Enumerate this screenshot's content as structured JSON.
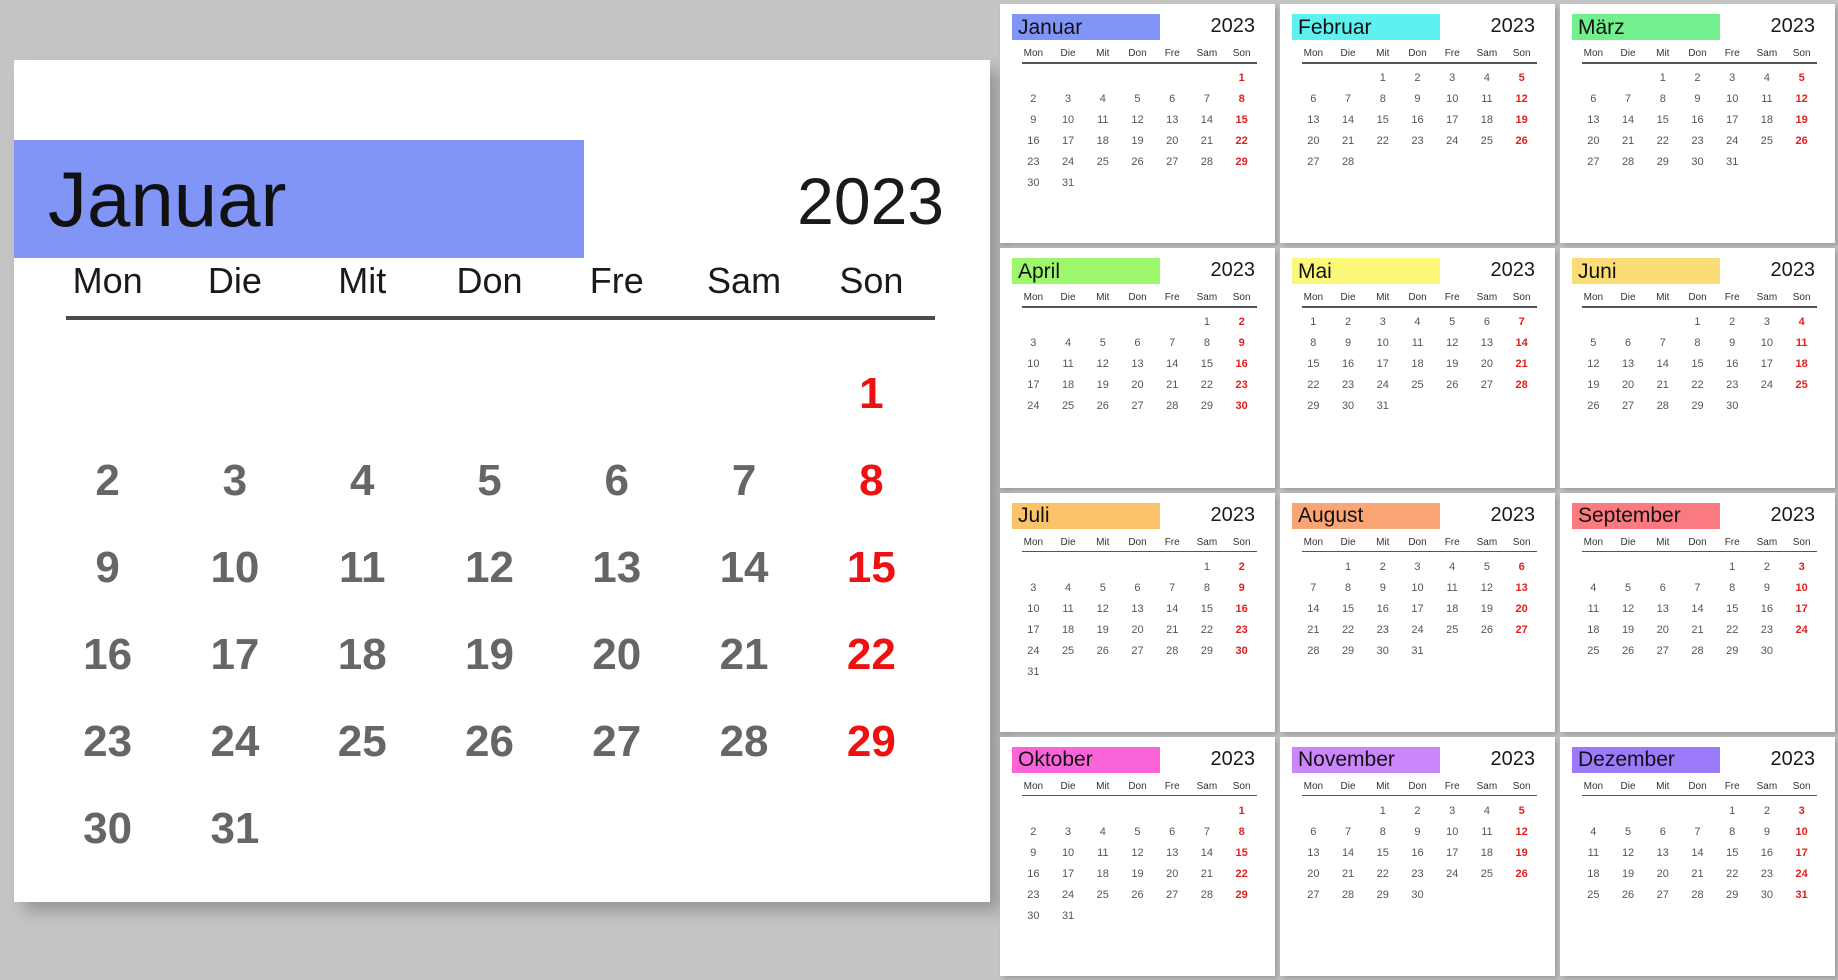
{
  "year": "2023",
  "weekdays": [
    "Mon",
    "Die",
    "Mit",
    "Don",
    "Fre",
    "Sam",
    "Son"
  ],
  "colors": {
    "page_background": "#c4c4c4",
    "panel_background": "#ffffff",
    "weekday_text": "#1a1a1a",
    "day_text": "#666666",
    "sunday_text": "#ee1111",
    "rule": "#4a4a4a"
  },
  "main": {
    "month": "Januar",
    "year": "2023",
    "band_color": "#8095f5",
    "weekdays": [
      "Mon",
      "Die",
      "Mit",
      "Don",
      "Fre",
      "Sam",
      "Son"
    ],
    "leading_blanks": 6,
    "days_in_month": 31,
    "weeks": [
      [
        "",
        "",
        "",
        "",
        "",
        "",
        "1"
      ],
      [
        "2",
        "3",
        "4",
        "5",
        "6",
        "7",
        "8"
      ],
      [
        "9",
        "10",
        "11",
        "12",
        "13",
        "14",
        "15"
      ],
      [
        "16",
        "17",
        "18",
        "19",
        "20",
        "21",
        "22"
      ],
      [
        "23",
        "24",
        "25",
        "26",
        "27",
        "28",
        "29"
      ],
      [
        "30",
        "31",
        "",
        "",
        "",
        "",
        ""
      ]
    ]
  },
  "months": [
    {
      "name": "Januar",
      "year": "2023",
      "band_color": "#8095f5",
      "leading_blanks": 6,
      "days_in_month": 31,
      "weeks": [
        [
          "",
          "",
          "",
          "",
          "",
          "",
          "1"
        ],
        [
          "2",
          "3",
          "4",
          "5",
          "6",
          "7",
          "8"
        ],
        [
          "9",
          "10",
          "11",
          "12",
          "13",
          "14",
          "15"
        ],
        [
          "16",
          "17",
          "18",
          "19",
          "20",
          "21",
          "22"
        ],
        [
          "23",
          "24",
          "25",
          "26",
          "27",
          "28",
          "29"
        ],
        [
          "30",
          "31",
          "",
          "",
          "",
          "",
          ""
        ]
      ]
    },
    {
      "name": "Februar",
      "year": "2023",
      "band_color": "#5ff0f0",
      "leading_blanks": 2,
      "days_in_month": 28,
      "weeks": [
        [
          "",
          "",
          "1",
          "2",
          "3",
          "4",
          "5"
        ],
        [
          "6",
          "7",
          "8",
          "9",
          "10",
          "11",
          "12"
        ],
        [
          "13",
          "14",
          "15",
          "16",
          "17",
          "18",
          "19"
        ],
        [
          "20",
          "21",
          "22",
          "23",
          "24",
          "25",
          "26"
        ],
        [
          "27",
          "28",
          "",
          "",
          "",
          "",
          ""
        ],
        [
          "",
          "",
          "",
          "",
          "",
          "",
          ""
        ]
      ]
    },
    {
      "name": "März",
      "year": "2023",
      "band_color": "#72f08e",
      "leading_blanks": 2,
      "days_in_month": 31,
      "weeks": [
        [
          "",
          "",
          "1",
          "2",
          "3",
          "4",
          "5"
        ],
        [
          "6",
          "7",
          "8",
          "9",
          "10",
          "11",
          "12"
        ],
        [
          "13",
          "14",
          "15",
          "16",
          "17",
          "18",
          "19"
        ],
        [
          "20",
          "21",
          "22",
          "23",
          "24",
          "25",
          "26"
        ],
        [
          "27",
          "28",
          "29",
          "30",
          "31",
          "",
          ""
        ],
        [
          "",
          "",
          "",
          "",
          "",
          "",
          ""
        ]
      ]
    },
    {
      "name": "April",
      "year": "2023",
      "band_color": "#9cf76a",
      "leading_blanks": 5,
      "days_in_month": 30,
      "weeks": [
        [
          "",
          "",
          "",
          "",
          "",
          "1",
          "2"
        ],
        [
          "3",
          "4",
          "5",
          "6",
          "7",
          "8",
          "9"
        ],
        [
          "10",
          "11",
          "12",
          "13",
          "14",
          "15",
          "16"
        ],
        [
          "17",
          "18",
          "19",
          "20",
          "21",
          "22",
          "23"
        ],
        [
          "24",
          "25",
          "26",
          "27",
          "28",
          "29",
          "30"
        ],
        [
          "",
          "",
          "",
          "",
          "",
          "",
          ""
        ]
      ]
    },
    {
      "name": "Mai",
      "year": "2023",
      "band_color": "#fbf87a",
      "leading_blanks": 0,
      "days_in_month": 31,
      "weeks": [
        [
          "1",
          "2",
          "3",
          "4",
          "5",
          "6",
          "7"
        ],
        [
          "8",
          "9",
          "10",
          "11",
          "12",
          "13",
          "14"
        ],
        [
          "15",
          "16",
          "17",
          "18",
          "19",
          "20",
          "21"
        ],
        [
          "22",
          "23",
          "24",
          "25",
          "26",
          "27",
          "28"
        ],
        [
          "29",
          "30",
          "31",
          "",
          "",
          "",
          ""
        ],
        [
          "",
          "",
          "",
          "",
          "",
          "",
          ""
        ]
      ]
    },
    {
      "name": "Juni",
      "year": "2023",
      "band_color": "#fbdd78",
      "leading_blanks": 3,
      "days_in_month": 30,
      "weeks": [
        [
          "",
          "",
          "",
          "1",
          "2",
          "3",
          "4"
        ],
        [
          "5",
          "6",
          "7",
          "8",
          "9",
          "10",
          "11"
        ],
        [
          "12",
          "13",
          "14",
          "15",
          "16",
          "17",
          "18"
        ],
        [
          "19",
          "20",
          "21",
          "22",
          "23",
          "24",
          "25"
        ],
        [
          "26",
          "27",
          "28",
          "29",
          "30",
          "",
          ""
        ],
        [
          "",
          "",
          "",
          "",
          "",
          "",
          ""
        ]
      ]
    },
    {
      "name": "Juli",
      "year": "2023",
      "band_color": "#fbc46a",
      "leading_blanks": 5,
      "days_in_month": 31,
      "weeks": [
        [
          "",
          "",
          "",
          "",
          "",
          "1",
          "2"
        ],
        [
          "3",
          "4",
          "5",
          "6",
          "7",
          "8",
          "9"
        ],
        [
          "10",
          "11",
          "12",
          "13",
          "14",
          "15",
          "16"
        ],
        [
          "17",
          "18",
          "19",
          "20",
          "21",
          "22",
          "23"
        ],
        [
          "24",
          "25",
          "26",
          "27",
          "28",
          "29",
          "30"
        ],
        [
          "31",
          "",
          "",
          "",
          "",
          "",
          ""
        ]
      ]
    },
    {
      "name": "August",
      "year": "2023",
      "band_color": "#fba474",
      "leading_blanks": 1,
      "days_in_month": 31,
      "weeks": [
        [
          "",
          "1",
          "2",
          "3",
          "4",
          "5",
          "6"
        ],
        [
          "7",
          "8",
          "9",
          "10",
          "11",
          "12",
          "13"
        ],
        [
          "14",
          "15",
          "16",
          "17",
          "18",
          "19",
          "20"
        ],
        [
          "21",
          "22",
          "23",
          "24",
          "25",
          "26",
          "27"
        ],
        [
          "28",
          "29",
          "30",
          "31",
          "",
          "",
          ""
        ],
        [
          "",
          "",
          "",
          "",
          "",
          "",
          ""
        ]
      ]
    },
    {
      "name": "September",
      "year": "2023",
      "band_color": "#fb7a7f",
      "leading_blanks": 4,
      "days_in_month": 30,
      "weeks": [
        [
          "",
          "",
          "",
          "",
          "1",
          "2",
          "3"
        ],
        [
          "4",
          "5",
          "6",
          "7",
          "8",
          "9",
          "10"
        ],
        [
          "11",
          "12",
          "13",
          "14",
          "15",
          "16",
          "17"
        ],
        [
          "18",
          "19",
          "20",
          "21",
          "22",
          "23",
          "24"
        ],
        [
          "25",
          "26",
          "27",
          "28",
          "29",
          "30",
          ""
        ],
        [
          "",
          "",
          "",
          "",
          "",
          "",
          ""
        ]
      ]
    },
    {
      "name": "Oktober",
      "year": "2023",
      "band_color": "#fb63d8",
      "leading_blanks": 6,
      "days_in_month": 31,
      "weeks": [
        [
          "",
          "",
          "",
          "",
          "",
          "",
          "1"
        ],
        [
          "2",
          "3",
          "4",
          "5",
          "6",
          "7",
          "8"
        ],
        [
          "9",
          "10",
          "11",
          "12",
          "13",
          "14",
          "15"
        ],
        [
          "16",
          "17",
          "18",
          "19",
          "20",
          "21",
          "22"
        ],
        [
          "23",
          "24",
          "25",
          "26",
          "27",
          "28",
          "29"
        ],
        [
          "30",
          "31",
          "",
          "",
          "",
          "",
          ""
        ]
      ]
    },
    {
      "name": "November",
      "year": "2023",
      "band_color": "#cb86fb",
      "leading_blanks": 2,
      "days_in_month": 30,
      "weeks": [
        [
          "",
          "",
          "1",
          "2",
          "3",
          "4",
          "5"
        ],
        [
          "6",
          "7",
          "8",
          "9",
          "10",
          "11",
          "12"
        ],
        [
          "13",
          "14",
          "15",
          "16",
          "17",
          "18",
          "19"
        ],
        [
          "20",
          "21",
          "22",
          "23",
          "24",
          "25",
          "26"
        ],
        [
          "27",
          "28",
          "29",
          "30",
          "",
          "",
          ""
        ],
        [
          "",
          "",
          "",
          "",
          "",
          "",
          ""
        ]
      ]
    },
    {
      "name": "Dezember",
      "year": "2023",
      "band_color": "#9b7afb",
      "leading_blanks": 4,
      "days_in_month": 31,
      "weeks": [
        [
          "",
          "",
          "",
          "",
          "1",
          "2",
          "3"
        ],
        [
          "4",
          "5",
          "6",
          "7",
          "8",
          "9",
          "10"
        ],
        [
          "11",
          "12",
          "13",
          "14",
          "15",
          "16",
          "17"
        ],
        [
          "18",
          "19",
          "20",
          "21",
          "22",
          "23",
          "24"
        ],
        [
          "25",
          "26",
          "27",
          "28",
          "29",
          "30",
          "31"
        ],
        [
          "",
          "",
          "",
          "",
          "",
          "",
          ""
        ]
      ]
    }
  ]
}
